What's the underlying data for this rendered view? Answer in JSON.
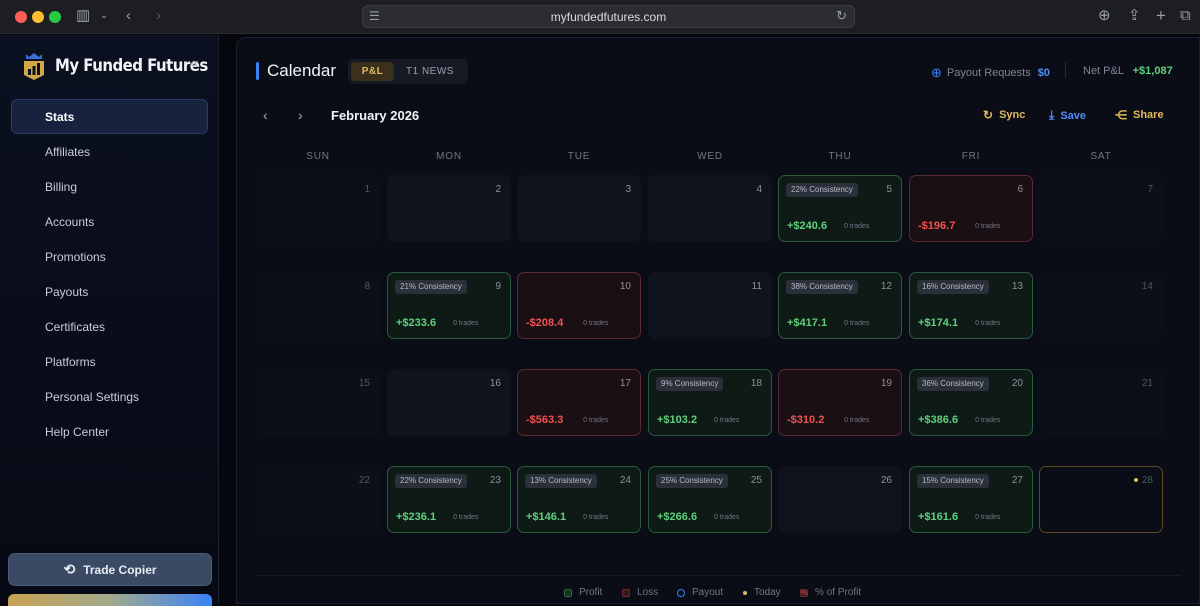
{
  "browser": {
    "url": "myfundedfutures.com"
  },
  "sidebar": {
    "brand": "My Funded Futures",
    "items": [
      {
        "label": "Stats",
        "active": true
      },
      {
        "label": "Affiliates"
      },
      {
        "label": "Billing"
      },
      {
        "label": "Accounts"
      },
      {
        "label": "Promotions"
      },
      {
        "label": "Payouts"
      },
      {
        "label": "Certificates"
      },
      {
        "label": "Platforms"
      },
      {
        "label": "Personal Settings"
      },
      {
        "label": "Help Center"
      }
    ],
    "trade_copier": "Trade Copier"
  },
  "header": {
    "title": "Calendar",
    "tabs": [
      "P&L",
      "T1 NEWS"
    ],
    "payout_requests_label": "Payout Requests",
    "payout_requests_value": "$0",
    "net_pnl_label": "Net P&L",
    "net_pnl_value": "+$1,087"
  },
  "toolbar": {
    "month": "February 2026",
    "sync": "Sync",
    "save": "Save",
    "share": "Share"
  },
  "weekdays": [
    "SUN",
    "MON",
    "TUE",
    "WED",
    "THU",
    "FRI",
    "SAT"
  ],
  "days": [
    {
      "day": "1"
    },
    {
      "day": "2"
    },
    {
      "day": "3"
    },
    {
      "day": "4"
    },
    {
      "day": "5",
      "consistency": "22% Consistency",
      "pnl": "+$240.6",
      "trades": "0 trades",
      "type": "profit"
    },
    {
      "day": "6",
      "pnl": "-$196.7",
      "trades": "0 trades",
      "type": "loss"
    },
    {
      "day": "7"
    },
    {
      "day": "8"
    },
    {
      "day": "9",
      "consistency": "21% Consistency",
      "pnl": "+$233.6",
      "trades": "0 trades",
      "type": "profit"
    },
    {
      "day": "10",
      "pnl": "-$208.4",
      "trades": "0 trades",
      "type": "loss"
    },
    {
      "day": "11"
    },
    {
      "day": "12",
      "consistency": "38% Consistency",
      "pnl": "+$417.1",
      "trades": "0 trades",
      "type": "profit"
    },
    {
      "day": "13",
      "consistency": "16% Consistency",
      "pnl": "+$174.1",
      "trades": "0 trades",
      "type": "profit"
    },
    {
      "day": "14"
    },
    {
      "day": "15"
    },
    {
      "day": "16"
    },
    {
      "day": "17",
      "pnl": "-$563.3",
      "trades": "0 trades",
      "type": "loss"
    },
    {
      "day": "18",
      "consistency": "9% Consistency",
      "pnl": "+$103.2",
      "trades": "0 trades",
      "type": "profit"
    },
    {
      "day": "19",
      "pnl": "-$310.2",
      "trades": "0 trades",
      "type": "loss"
    },
    {
      "day": "20",
      "consistency": "36% Consistency",
      "pnl": "+$386.6",
      "trades": "0 trades",
      "type": "profit"
    },
    {
      "day": "21"
    },
    {
      "day": "22"
    },
    {
      "day": "23",
      "consistency": "22% Consistency",
      "pnl": "+$236.1",
      "trades": "0 trades",
      "type": "profit"
    },
    {
      "day": "24",
      "consistency": "13% Consistency",
      "pnl": "+$146.1",
      "trades": "0 trades",
      "type": "profit"
    },
    {
      "day": "25",
      "consistency": "25% Consistency",
      "pnl": "+$266.6",
      "trades": "0 trades",
      "type": "profit"
    },
    {
      "day": "26"
    },
    {
      "day": "27",
      "consistency": "15% Consistency",
      "pnl": "+$161.6",
      "trades": "0 trades",
      "type": "profit"
    },
    {
      "day": "28",
      "today": true
    }
  ],
  "legend": [
    "Profit",
    "Loss",
    "Payout",
    "Today",
    "% of Profit"
  ],
  "colors": {
    "profit": "#5fd07c",
    "loss": "#ef5350",
    "accent": "#3b82f6",
    "gold": "#e1b85a"
  }
}
